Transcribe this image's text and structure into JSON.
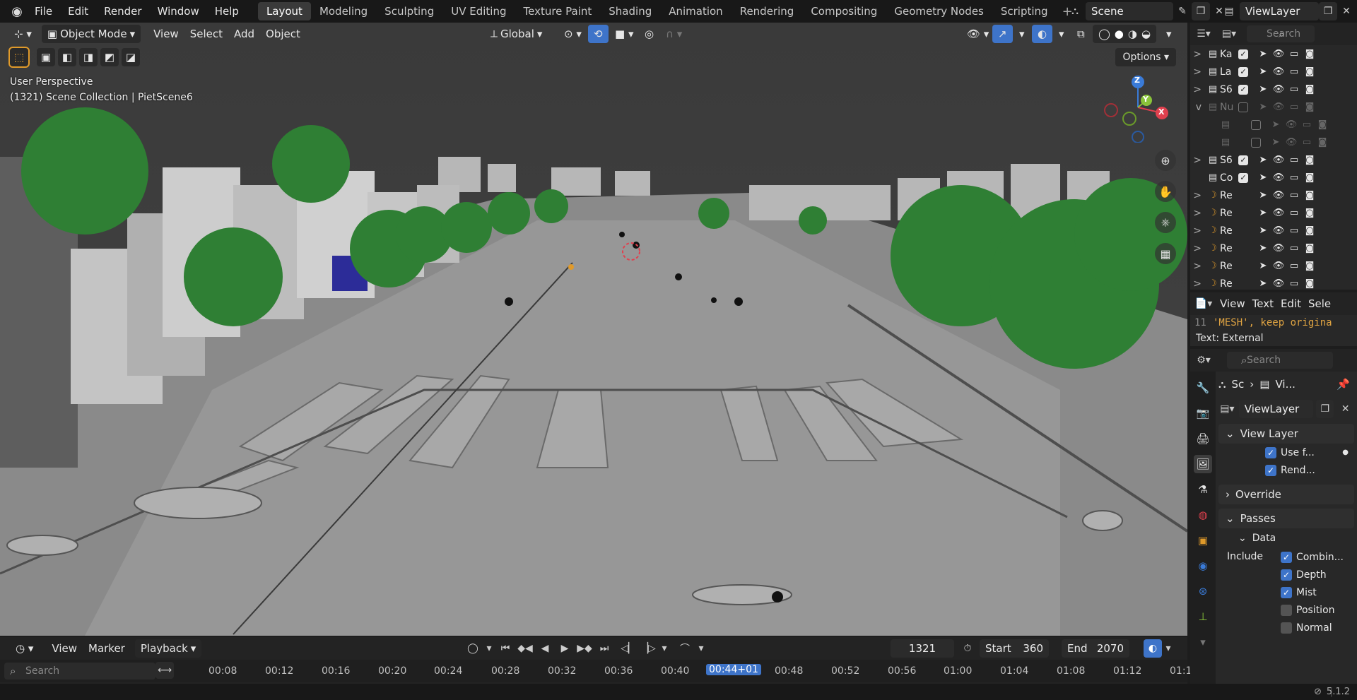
{
  "topbar": {
    "menus": [
      "File",
      "Edit",
      "Render",
      "Window",
      "Help"
    ],
    "workspaces": [
      "Layout",
      "Modeling",
      "Sculpting",
      "UV Editing",
      "Texture Paint",
      "Shading",
      "Animation",
      "Rendering",
      "Compositing",
      "Geometry Nodes",
      "Scripting"
    ],
    "active_workspace": "Layout",
    "add_symbol": "+",
    "scene_name": "Scene",
    "view_layer_name": "ViewLayer"
  },
  "viewport": {
    "mode": "Object Mode",
    "menus": [
      "View",
      "Select",
      "Add",
      "Object"
    ],
    "orientation": "Global",
    "overlay_title": "User Perspective",
    "overlay_subtitle": "(1321) Scene Collection | PietScene6",
    "options_label": "Options",
    "gizmo": {
      "x": "X",
      "y": "Y",
      "z": "Z"
    }
  },
  "outliner": {
    "search_placeholder": "Search",
    "rows": [
      {
        "name": "Ka",
        "checked": true,
        "dim": false,
        "expander": ">"
      },
      {
        "name": "La",
        "checked": true,
        "dim": false,
        "expander": ">"
      },
      {
        "name": "S6",
        "checked": true,
        "dim": false,
        "expander": ">"
      },
      {
        "name": "Nu",
        "checked": false,
        "dim": true,
        "expander": "v"
      },
      {
        "name": "",
        "checked": false,
        "dim": true,
        "expander": ""
      },
      {
        "name": "",
        "checked": false,
        "dim": true,
        "expander": ""
      },
      {
        "name": "S6",
        "checked": true,
        "dim": false,
        "expander": ">"
      },
      {
        "name": "Co",
        "checked": true,
        "dim": false,
        "expander": ""
      },
      {
        "name": "Re",
        "checked": null,
        "dim": false,
        "expander": ">"
      },
      {
        "name": "Re",
        "checked": null,
        "dim": false,
        "expander": ">"
      },
      {
        "name": "Re",
        "checked": null,
        "dim": false,
        "expander": ">"
      },
      {
        "name": "Re",
        "checked": null,
        "dim": false,
        "expander": ">"
      },
      {
        "name": "Re",
        "checked": null,
        "dim": false,
        "expander": ">"
      },
      {
        "name": "Re",
        "checked": null,
        "dim": false,
        "expander": ">"
      }
    ]
  },
  "text_editor": {
    "menus": [
      "View",
      "Text",
      "Edit",
      "Sele"
    ],
    "line_no": "11",
    "line_code": "'MESH', keep origina",
    "status": "Text: External"
  },
  "properties": {
    "search_placeholder": "Search",
    "breadcrumb_a": "Sc",
    "breadcrumb_b": "Vi...",
    "view_layer_field": "ViewLayer",
    "panel_view_layer": "View Layer",
    "use_for": "Use f...",
    "render_single": "Rend...",
    "panel_override": "Override",
    "panel_passes": "Passes",
    "panel_data": "Data",
    "include_label": "Include",
    "passes": [
      {
        "label": "Combin...",
        "checked": true
      },
      {
        "label": "Depth",
        "checked": true
      },
      {
        "label": "Mist",
        "checked": true
      },
      {
        "label": "Position",
        "checked": false
      },
      {
        "label": "Normal",
        "checked": false
      }
    ]
  },
  "timeline": {
    "menus": [
      "View",
      "Marker",
      "Playback"
    ],
    "search_placeholder": "Search",
    "current_frame": "1321",
    "start_label": "Start",
    "start_value": "360",
    "end_label": "End",
    "end_value": "2070",
    "ticks": [
      "00:08",
      "00:12",
      "00:16",
      "00:20",
      "00:24",
      "00:28",
      "00:32",
      "00:36",
      "00:40",
      "00:44+01",
      "00:48",
      "00:52",
      "00:56",
      "01:00",
      "01:04",
      "01:08",
      "01:12",
      "01:1"
    ],
    "current_tick": "00:44+01"
  },
  "status": {
    "version": "5.1.2"
  },
  "colors": {
    "accent": "#3e74c9",
    "active_tool": "#e09a2a",
    "x_axis": "#e0404e",
    "y_axis": "#8ac43a",
    "z_axis": "#3a7bd8"
  }
}
